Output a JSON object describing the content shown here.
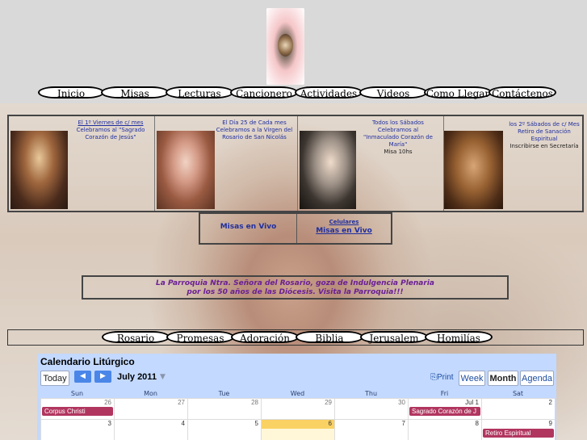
{
  "nav_top": [
    "Inicio",
    "Misas",
    "Lecturas",
    "Cancionero",
    "Actividades",
    "Videos",
    "Como Llegar",
    "Contáctenos"
  ],
  "strip": [
    {
      "link": "El 1º Viernes de c/ mes",
      "text": "Celebramos al \"Sagrado Corazón de Jesús\""
    },
    {
      "text": "El Día 25 de Cada mes Celebramos a la Virgen del Rosario de San Nicolás"
    },
    {
      "text": "Todos los Sábados Celebramos al \"Inmaculado Corazón de María\"",
      "extra": "Misa  10hs"
    },
    {
      "text": "los 2º Sábados de c/ Mes Retiro de Sanación Espiritual",
      "extra": "Inscribirse en Secretaría"
    }
  ],
  "vivo": {
    "left": "Misas en Vivo",
    "small": "Celulares",
    "right": "Misas en Vivo"
  },
  "indulgencia": {
    "line1": "La Parroquia Ntra. Señora del Rosario, goza de Indulgencia Plenaria",
    "line2": "por los 50 años de las Diócesis.   Visita la Parroquia!!!"
  },
  "nav_bottom": [
    "Rosario",
    "Promesas",
    "Adoración",
    "Biblia",
    "Jerusalem",
    "Homilías"
  ],
  "calendar": {
    "title": "Calendario Litúrgico",
    "today": "Today",
    "month": "July 2011",
    "print": "Print",
    "views": [
      "Week",
      "Month",
      "Agenda"
    ],
    "days": [
      "Sun",
      "Mon",
      "Tue",
      "Wed",
      "Thu",
      "Fri",
      "Sat"
    ],
    "week1": [
      "26",
      "27",
      "28",
      "29",
      "30",
      "Jul 1",
      "2"
    ],
    "week2": [
      "3",
      "4",
      "5",
      "6",
      "7",
      "8",
      "9"
    ],
    "events": {
      "corpus": "Corpus Christi",
      "sagrado": "Sagrado Corazón de J",
      "retiro": "Retiro Espiritual"
    },
    "event_color": "#b1365f",
    "today_color": "#fad163"
  }
}
